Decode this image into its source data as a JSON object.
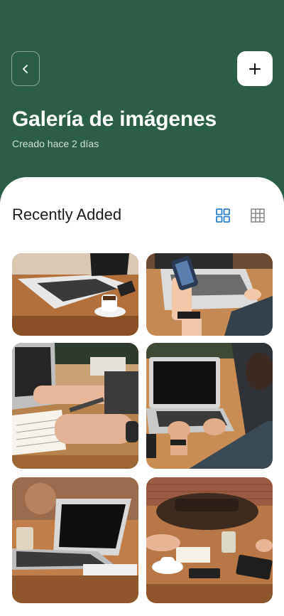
{
  "header": {
    "title": "Galería de imágenes",
    "subtitle": "Creado hace 2 días",
    "back_icon": "chevron-left-icon",
    "add_icon": "plus-icon",
    "color": "#2c5d46"
  },
  "gallery": {
    "section_title": "Recently Added",
    "views": [
      {
        "icon": "grid-large-icon",
        "active": true,
        "color": "#2f7fd1"
      },
      {
        "icon": "grid-small-icon",
        "active": false,
        "color": "#8a8a8a"
      }
    ],
    "photos": [
      {
        "alt": "laptop with coffee cup on wooden desk"
      },
      {
        "alt": "hands holding phone over laptop"
      },
      {
        "alt": "person writing in notebook beside laptop"
      },
      {
        "alt": "person typing on laptop at wooden table"
      },
      {
        "alt": "laptop on table with glass of water"
      },
      {
        "alt": "people meeting at table with bag and laptop"
      }
    ]
  }
}
